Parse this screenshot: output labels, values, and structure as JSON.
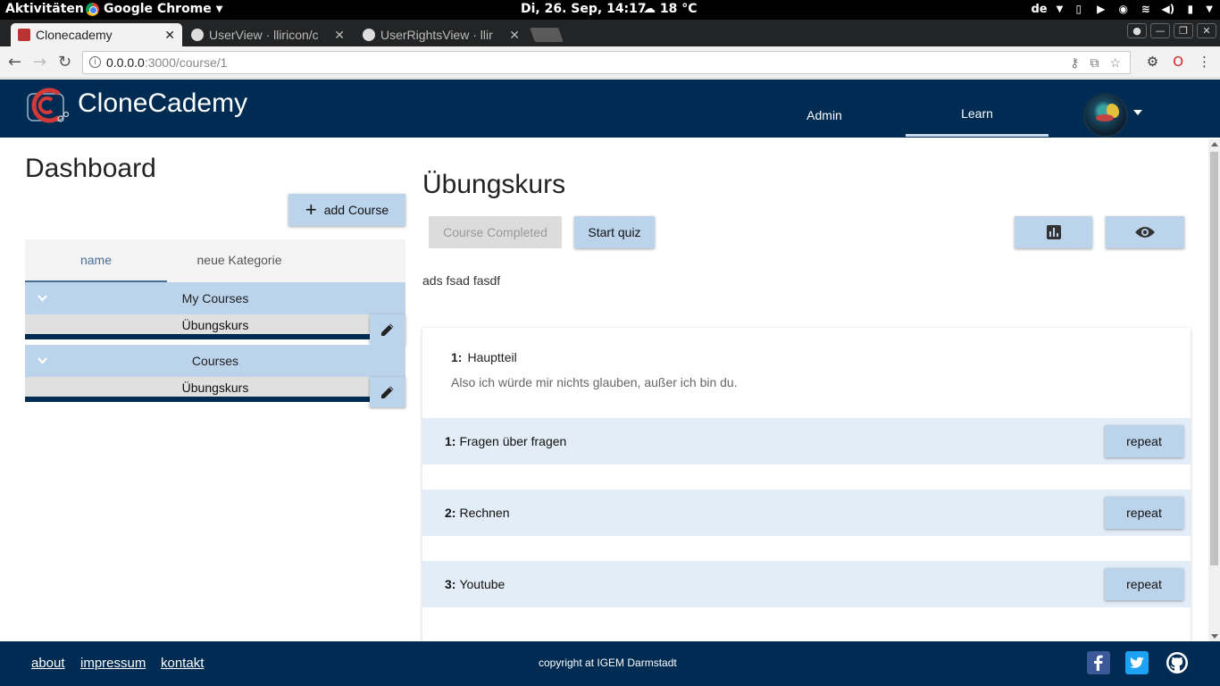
{
  "system_bar": {
    "activities": "Aktivitäten",
    "app_name": "Google Chrome",
    "clock": "Di, 26. Sep, 14:17",
    "weather": "18 °C",
    "keyboard_layout": "de"
  },
  "browser": {
    "tabs": [
      {
        "title": "Clonecademy",
        "active": true
      },
      {
        "title": "UserView · lliricon/c",
        "active": false
      },
      {
        "title": "UserRightsView · llir",
        "active": false
      }
    ],
    "url_host": "0.0.0.0",
    "url_path": ":3000/course/1"
  },
  "header": {
    "brand": "CloneCademy",
    "nav": {
      "admin": "Admin",
      "learn": "Learn"
    }
  },
  "sidebar": {
    "title": "Dashboard",
    "add_course_label": "add Course",
    "tabs": {
      "name": "name",
      "category": "neue Kategorie"
    },
    "groups": [
      {
        "label": "My Courses",
        "items": [
          "Übungskurs"
        ]
      },
      {
        "label": "Courses",
        "items": [
          "Übungskurs"
        ]
      }
    ]
  },
  "course": {
    "title": "Übungskurs",
    "completed_label": "Course Completed",
    "start_quiz_label": "Start quiz",
    "description": "ads fsad fasdf",
    "section": {
      "number": "1:",
      "title": "Hauptteil",
      "subtitle": "Also ich würde mir nichts glauben, außer ich bin du."
    },
    "lessons": [
      {
        "number": "1:",
        "title": "Fragen über fragen",
        "action": "repeat"
      },
      {
        "number": "2:",
        "title": "Rechnen",
        "action": "repeat"
      },
      {
        "number": "3:",
        "title": "Youtube",
        "action": "repeat"
      }
    ]
  },
  "footer": {
    "links": {
      "about": "about",
      "impressum": "impressum",
      "kontakt": "kontakt"
    },
    "copyright": "copyright at IGEM Darmstadt"
  },
  "colors": {
    "primary_dark": "#002b52",
    "accent_light": "#bcd3ec",
    "lesson_bg": "#e3edf7"
  }
}
